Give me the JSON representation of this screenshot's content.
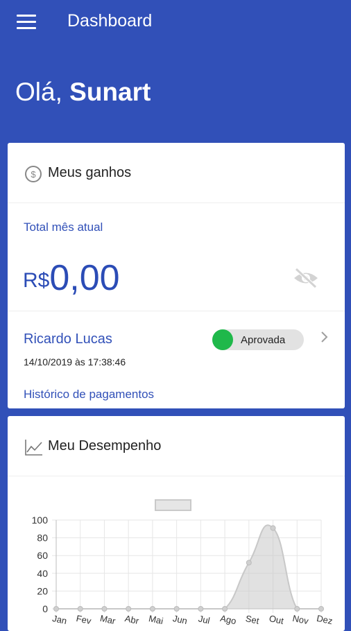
{
  "appbar": {
    "title": "Dashboard",
    "menu_icon": "hamburger-icon"
  },
  "greeting": {
    "prefix": "Olá, ",
    "user": "Sunart"
  },
  "earnings_card": {
    "title": "Meus ganhos",
    "icon": "dollar-circle-icon",
    "month_label": "Total mês atual",
    "currency": "R$",
    "amount": "0,00",
    "visibility_icon": "eye-off-icon",
    "entry": {
      "name": "Ricardo Lucas",
      "datetime": "14/10/2019 às 17:38:46",
      "status": "Aprovada",
      "status_color": "#1fb84a"
    },
    "history_link": "Histórico de pagamentos"
  },
  "performance_card": {
    "title": "Meu Desempenho",
    "icon": "line-chart-icon"
  },
  "chart_data": {
    "type": "area",
    "categories": [
      "Jan",
      "Fev",
      "Mar",
      "Abr",
      "Mai",
      "Jun",
      "Jul",
      "Ago",
      "Set",
      "Out",
      "Nov",
      "Dez"
    ],
    "series": [
      {
        "values": [
          0,
          0,
          0,
          0,
          0,
          0,
          0,
          0,
          52,
          91,
          0,
          0
        ],
        "color": "#c8c8c8"
      }
    ],
    "yticks": [
      "0",
      "20",
      "40",
      "60",
      "80",
      "100"
    ],
    "ylim": [
      0,
      100
    ],
    "grid": true,
    "legend": "top-center",
    "colors": {
      "brand": "#3150b8",
      "grid": "#e6e6e6",
      "axis": "#333333"
    }
  }
}
